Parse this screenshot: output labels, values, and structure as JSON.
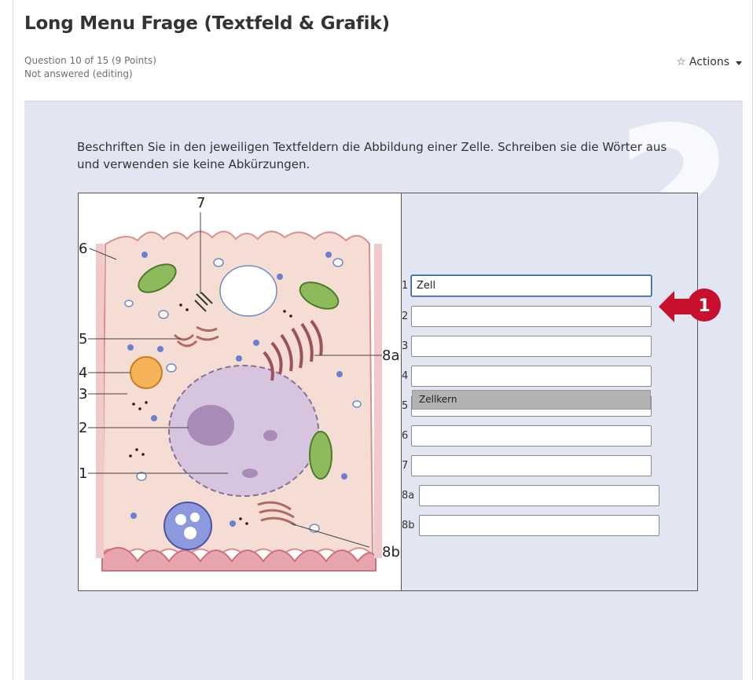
{
  "header": {
    "title": "Long Menu Frage (Textfeld & Grafik)",
    "question_info": "Question 10 of 15 (9 Points)",
    "status": "Not answered (editing)",
    "actions_label": "Actions",
    "actions_icon": "star-outline-icon"
  },
  "question": {
    "text": "Beschriften Sie in den jeweiligen Textfeldern die Abbildung einer Zelle. Schreiben sie die Wörter aus und verwenden sie keine Abkürzungen.",
    "watermark": "?"
  },
  "image_labels": [
    "7",
    "6",
    "5",
    "4",
    "3",
    "2",
    "1",
    "8a",
    "8b"
  ],
  "gaps": [
    {
      "number": "1",
      "value": "Zell"
    },
    {
      "number": "2",
      "value": ""
    },
    {
      "number": "3",
      "value": ""
    },
    {
      "number": "4",
      "value": ""
    },
    {
      "number": "5",
      "value": ""
    },
    {
      "number": "6",
      "value": ""
    },
    {
      "number": "7",
      "value": ""
    },
    {
      "number": "8a",
      "value": ""
    },
    {
      "number": "8b",
      "value": ""
    }
  ],
  "autocomplete": {
    "suggestion": "Zellkern"
  },
  "callout": {
    "number": "1",
    "color": "#c8102e"
  },
  "colors": {
    "panel_bg": "#e2e6f3",
    "cell_fill": "#f6ddd3",
    "membrane": "#e38a98",
    "nucleus": "#cbb6d6"
  }
}
